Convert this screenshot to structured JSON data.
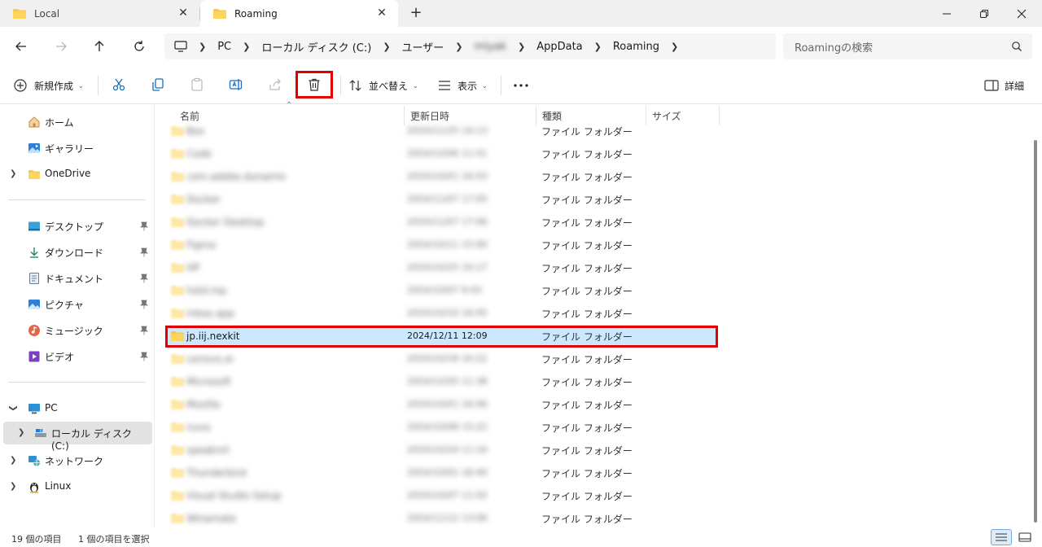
{
  "tabs": [
    {
      "label": "Local"
    },
    {
      "label": "Roaming"
    }
  ],
  "address": {
    "crumbs": [
      "PC",
      "ローカル ディスク (C:)",
      "ユーザー",
      "miyak",
      "AppData",
      "Roaming"
    ],
    "search_placeholder": "Roamingの検索"
  },
  "toolbar": {
    "new_label": "新規作成",
    "sort_label": "並べ替え",
    "view_label": "表示",
    "details_label": "詳細"
  },
  "sidebar": {
    "items": [
      {
        "label": "ホーム"
      },
      {
        "label": "ギャラリー"
      },
      {
        "label": "OneDrive"
      },
      {
        "label": "デスクトップ"
      },
      {
        "label": "ダウンロード"
      },
      {
        "label": "ドキュメント"
      },
      {
        "label": "ピクチャ"
      },
      {
        "label": "ミュージック"
      },
      {
        "label": "ビデオ"
      },
      {
        "label": "PC"
      },
      {
        "label": "ローカル ディスク (C:)"
      },
      {
        "label": "ネットワーク"
      },
      {
        "label": "Linux"
      }
    ]
  },
  "columns": {
    "name": "名前",
    "modified": "更新日時",
    "type": "種類",
    "size": "サイズ"
  },
  "files": [
    {
      "name": "Box",
      "date": "2024/11/25 14:13",
      "type": "ファイル フォルダー"
    },
    {
      "name": "Code",
      "date": "2024/12/06 11:51",
      "type": "ファイル フォルダー"
    },
    {
      "name": "com.adobe.dunamis",
      "date": "2024/10/01 16:03",
      "type": "ファイル フォルダー"
    },
    {
      "name": "Docker",
      "date": "2024/11/07 17:05",
      "type": "ファイル フォルダー"
    },
    {
      "name": "Docker Desktop",
      "date": "2024/11/07 17:06",
      "type": "ファイル フォルダー"
    },
    {
      "name": "Figma",
      "date": "2024/10/11 15:00",
      "type": "ファイル フォルダー"
    },
    {
      "name": "HP",
      "date": "2024/10/25 10:17",
      "type": "ファイル フォルダー"
    },
    {
      "name": "hstd.mp",
      "date": "2024/10/07 9:43",
      "type": "ファイル フォルダー"
    },
    {
      "name": "inbox.app",
      "date": "2024/10/10 16:05",
      "type": "ファイル フォルダー"
    },
    {
      "name": "jp.iij.nexkit",
      "date": "2024/12/11 12:09",
      "type": "ファイル フォルダー"
    },
    {
      "name": "Lenovo.ai",
      "date": "2024/10/18 10:22",
      "type": "ファイル フォルダー"
    },
    {
      "name": "Microsoft",
      "date": "2024/12/05 11:38",
      "type": "ファイル フォルダー"
    },
    {
      "name": "Mozilla",
      "date": "2024/10/01 16:06",
      "type": "ファイル フォルダー"
    },
    {
      "name": "nuvo",
      "date": "2024/10/08 15:22",
      "type": "ファイル フォルダー"
    },
    {
      "name": "speaknrt",
      "date": "2024/10/24 11:16",
      "type": "ファイル フォルダー"
    },
    {
      "name": "Thunderbird",
      "date": "2024/10/01 16:40",
      "type": "ファイル フォルダー"
    },
    {
      "name": "Visual Studio Setup",
      "date": "2024/10/07 11:02",
      "type": "ファイル フォルダー"
    },
    {
      "name": "Winamate",
      "date": "2024/11/12 13:06",
      "type": "ファイル フォルダー"
    }
  ],
  "selected_index": 9,
  "status": {
    "count": "19 個の項目",
    "selected": "1 個の項目を選択"
  },
  "colors": {
    "folder": "#f7c948",
    "selection": "#cce8ff",
    "annotation": "#e00000"
  }
}
